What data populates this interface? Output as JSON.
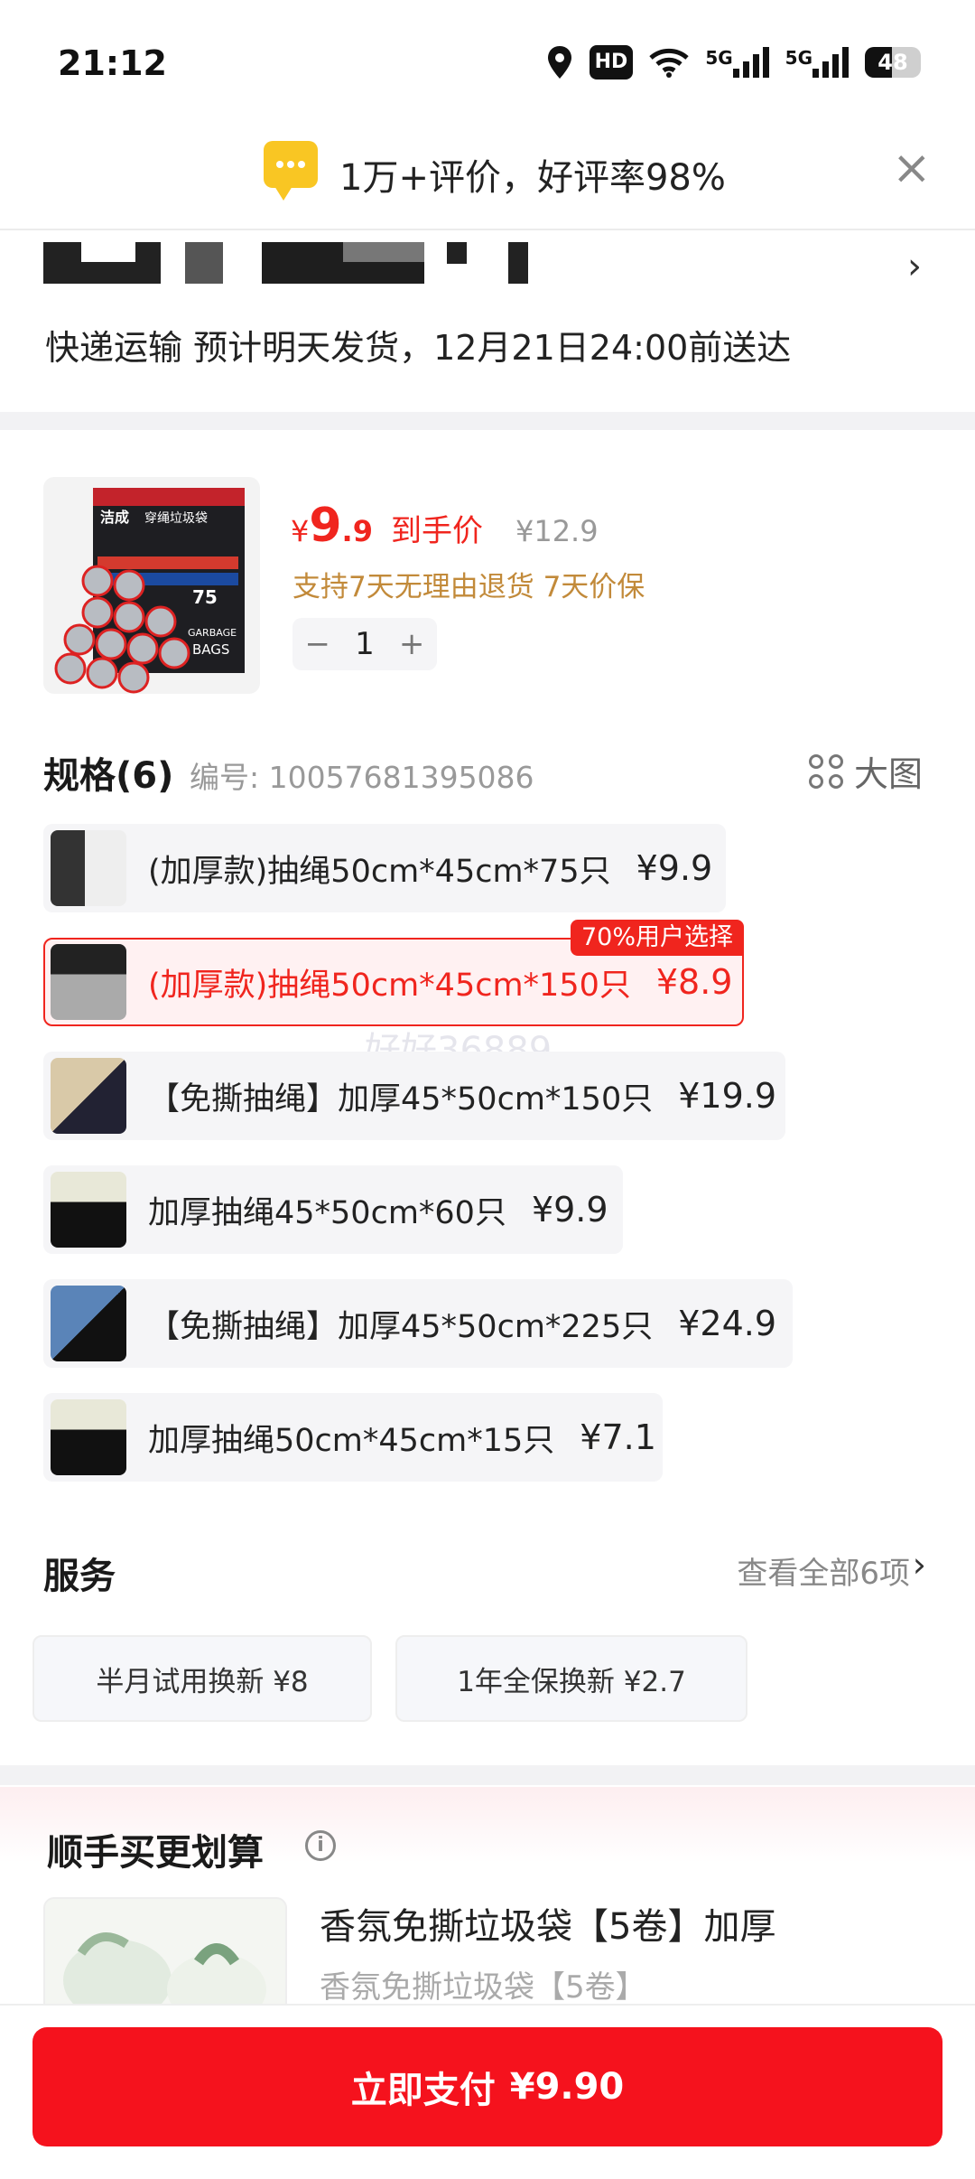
{
  "status_bar": {
    "time": "21:12",
    "hd": "HD",
    "net1": "5G",
    "net2": "5G",
    "battery": "48",
    "battery_level": 0.48
  },
  "banner": {
    "text": "1万+评价，好评率98%",
    "close": "×"
  },
  "shipping": {
    "arrow": "›",
    "text": "快递运输 预计明天发货，12月21日24:00前送达"
  },
  "product": {
    "currency": "¥",
    "price_int": "9",
    "price_dec": ".9",
    "price_label": "到手价",
    "original_price": "¥12.9",
    "promo": "支持7天无理由退货 7天价保",
    "qty_minus": "−",
    "quantity": "1",
    "qty_plus": "+",
    "image_text": {
      "brand": "洁成",
      "name": "穿绳垃圾袋",
      "count": "75",
      "line1": "GARBAGE",
      "line2": "BAGS"
    }
  },
  "specs": {
    "title": "规格(6)",
    "number": "编号: 10057681395086",
    "big_view": "大图",
    "options": [
      {
        "label": "(加厚款)抽绳50cm*45cm*75只",
        "price": "¥9.9"
      },
      {
        "label": "(加厚款)抽绳50cm*45cm*150只",
        "price": "¥8.9",
        "badge": "70%用户选择",
        "selected": true
      },
      {
        "label": "【免撕抽绳】加厚45*50cm*150只",
        "price": "¥19.9"
      },
      {
        "label": "加厚抽绳45*50cm*60只",
        "price": "¥9.9"
      },
      {
        "label": "【免撕抽绳】加厚45*50cm*225只",
        "price": "¥24.9"
      },
      {
        "label": "加厚抽绳50cm*45cm*15只",
        "price": "¥7.1"
      }
    ]
  },
  "watermark": "好好36889",
  "services": {
    "title": "服务",
    "view_all": "查看全部6项",
    "chevron": "›",
    "items": [
      {
        "label": "半月试用换新 ¥8"
      },
      {
        "label": "1年全保换新 ¥2.7"
      }
    ]
  },
  "addon": {
    "title": "顺手买更划算",
    "info": "i",
    "item_name": "香氛免撕垃圾袋【5卷】加厚",
    "item_sub": "香氛免撕垃圾袋【5卷】"
  },
  "bottom": {
    "pay_label": "立即支付",
    "pay_amount": "¥9.90"
  },
  "colors": {
    "accent": "#f0251e",
    "promo": "#c28a3a",
    "star": "#f9c623"
  }
}
